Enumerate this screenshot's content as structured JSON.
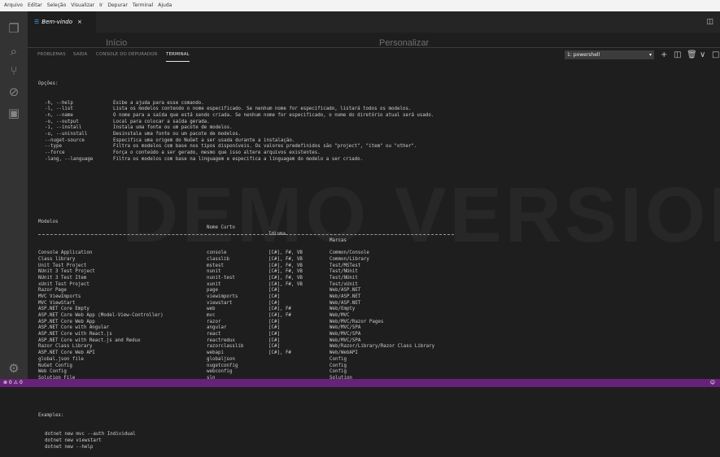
{
  "menu": [
    "Arquivo",
    "Editar",
    "Seleção",
    "Visualizar",
    "Ir",
    "Depurar",
    "Terminal",
    "Ajuda"
  ],
  "tab": {
    "label": "Bem-vindo",
    "close": "×"
  },
  "welcome": {
    "left_heading": "Início",
    "right_heading": "Personalizar"
  },
  "panel": {
    "tabs": [
      "PROBLEMAS",
      "SAÍDA",
      "CONSOLE DO DEPURADOR",
      "TERMINAL"
    ],
    "active_tab": "TERMINAL",
    "terminal_select": "1: powershell"
  },
  "terminal": {
    "options_header": "Opções:",
    "options": [
      {
        "flag": "-h, --help",
        "desc": "Exibe a ajuda para esse comando."
      },
      {
        "flag": "-l, --list",
        "desc": "Lista os modelos contendo o nome especificado. Se nenhum nome for especificado, listará todos os modelos."
      },
      {
        "flag": "-n, --name",
        "desc": "O nome para a saída que está sendo criada. Se nenhum nome for especificado, o nome do diretório atual será usado."
      },
      {
        "flag": "-o, --output",
        "desc": "Local para colocar a saída gerada."
      },
      {
        "flag": "-i, --install",
        "desc": "Instala uma fonte ou um pacote de modelos."
      },
      {
        "flag": "-u, --uninstall",
        "desc": "Desinstala uma fonte ou um pacote de modelos."
      },
      {
        "flag": "--nuget-source",
        "desc": "Especifica uma origem do NuGet a ser usada durante a instalação."
      },
      {
        "flag": "--type",
        "desc": "Filtra os modelos com base nos tipos disponíveis. Os valores predefinidos são \"project\", \"item\" ou \"other\"."
      },
      {
        "flag": "--force",
        "desc": "Força o conteúdo a ser gerado, mesmo que isso altere arquivos existentes."
      },
      {
        "flag": "-lang, --language",
        "desc": "Filtra os modelos com base na linguagem e especifica a linguagem do modelo a ser criado."
      }
    ],
    "columns": [
      "Modelos",
      "Nome Curto",
      "Idioma",
      "Marcas"
    ],
    "rows": [
      [
        "Console Application",
        "console",
        "[C#], F#, VB",
        "Common/Console"
      ],
      [
        "Class library",
        "classlib",
        "[C#], F#, VB",
        "Common/Library"
      ],
      [
        "Unit Test Project",
        "mstest",
        "[C#], F#, VB",
        "Test/MSTest"
      ],
      [
        "NUnit 3 Test Project",
        "nunit",
        "[C#], F#, VB",
        "Test/NUnit"
      ],
      [
        "NUnit 3 Test Item",
        "nunit-test",
        "[C#], F#, VB",
        "Test/NUnit"
      ],
      [
        "xUnit Test Project",
        "xunit",
        "[C#], F#, VB",
        "Test/xUnit"
      ],
      [
        "Razor Page",
        "page",
        "[C#]",
        "Web/ASP.NET"
      ],
      [
        "MVC ViewImports",
        "viewimports",
        "[C#]",
        "Web/ASP.NET"
      ],
      [
        "MVC ViewStart",
        "viewstart",
        "[C#]",
        "Web/ASP.NET"
      ],
      [
        "ASP.NET Core Empty",
        "web",
        "[C#], F#",
        "Web/Empty"
      ],
      [
        "ASP.NET Core Web App (Model-View-Controller)",
        "mvc",
        "[C#], F#",
        "Web/MVC"
      ],
      [
        "ASP.NET Core Web App",
        "razor",
        "[C#]",
        "Web/MVC/Razor Pages"
      ],
      [
        "ASP.NET Core with Angular",
        "angular",
        "[C#]",
        "Web/MVC/SPA"
      ],
      [
        "ASP.NET Core with React.js",
        "react",
        "[C#]",
        "Web/MVC/SPA"
      ],
      [
        "ASP.NET Core with React.js and Redux",
        "reactredux",
        "[C#]",
        "Web/MVC/SPA"
      ],
      [
        "Razor Class Library",
        "razorclasslib",
        "[C#]",
        "Web/Razor/Library/Razor Class Library"
      ],
      [
        "ASP.NET Core Web API",
        "webapi",
        "[C#], F#",
        "Web/WebAPI"
      ],
      [
        "global.json file",
        "globaljson",
        "",
        "Config"
      ],
      [
        "NuGet Config",
        "nugetconfig",
        "",
        "Config"
      ],
      [
        "Web Config",
        "webconfig",
        "",
        "Config"
      ],
      [
        "Solution File",
        "sln",
        "",
        "Solution"
      ]
    ],
    "examples_header": "Examples:",
    "examples": [
      "dotnet new mvc --auth Individual",
      "dotnet new viewstart",
      "dotnet new --help"
    ]
  },
  "watermark": "DEMO VERSION",
  "status": {
    "left": "⊗ 0 ⚠ 0"
  }
}
